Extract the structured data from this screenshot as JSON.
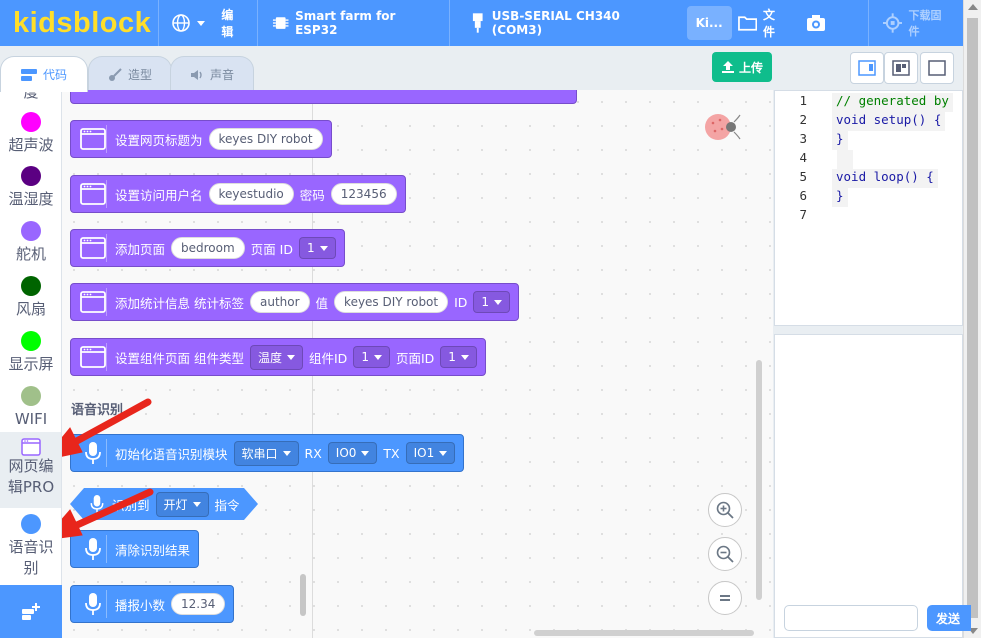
{
  "menubar": {
    "logo": "kidsblock",
    "edit": "编辑",
    "project": "Smart farm for ESP32",
    "port": "USB-SERIAL CH340 (COM3)",
    "kit": "Ki...",
    "file": "文件",
    "download_firmware": "下载固件"
  },
  "tabs": {
    "code": "代码",
    "costume": "造型",
    "sound": "声音"
  },
  "toolbar": {
    "upload": "上传"
  },
  "categories": [
    {
      "label": "度",
      "color": "#c0c0c0"
    },
    {
      "label": "超声波",
      "color": "#ff00ff"
    },
    {
      "label": "温湿度",
      "color": "#5b0082"
    },
    {
      "label": "舵机",
      "color": "#9966ff"
    },
    {
      "label": "风扇",
      "color": "#006400"
    },
    {
      "label": "显示屏",
      "color": "#00ff00"
    },
    {
      "label": "WIFI",
      "color": "#a0c08a"
    },
    {
      "label": "网页编辑PRO",
      "color": "#9966ff"
    },
    {
      "label": "语音识别",
      "color": "#4c97ff"
    }
  ],
  "blocks": {
    "set_title": {
      "label": "设置网页标题为",
      "value": "keyes DIY robot"
    },
    "set_user": {
      "label": "设置访问用户名",
      "user": "keyestudio",
      "pwd_label": "密码",
      "pwd": "123456"
    },
    "add_page": {
      "label": "添加页面",
      "name": "bedroom",
      "id_label": "页面 ID",
      "id": "1"
    },
    "add_stat": {
      "label": "添加统计信息 统计标签",
      "tag": "author",
      "val_label": "值",
      "val": "keyes DIY robot",
      "id_label": "ID",
      "id": "1"
    },
    "set_widget": {
      "label": "设置组件页面 组件类型",
      "type": "温度",
      "wid_label": "组件ID",
      "wid": "1",
      "pid_label": "页面ID",
      "pid": "1"
    },
    "section": "语音识别",
    "init_voice": {
      "label": "初始化语音识别模块",
      "mode": "软串口",
      "rx_label": "RX",
      "rx": "IO0",
      "tx_label": "TX",
      "tx": "IO1"
    },
    "recognized": {
      "label": "识别到",
      "cmd": "开灯",
      "suffix": "指令"
    },
    "clear": {
      "label": "清除识别结果"
    },
    "broadcast": {
      "label": "播报小数",
      "value": "12.34"
    }
  },
  "code": {
    "lines": [
      {
        "n": "1",
        "text": "// generated by",
        "type": "comment"
      },
      {
        "n": "2",
        "text": "void setup() {",
        "type": "code"
      },
      {
        "n": "3",
        "text": "}",
        "type": "code"
      },
      {
        "n": "4",
        "text": " ",
        "type": "code"
      },
      {
        "n": "5",
        "text": "void loop() {",
        "type": "code"
      },
      {
        "n": "6",
        "text": "}",
        "type": "code"
      },
      {
        "n": "7",
        "text": "",
        "type": "code"
      }
    ]
  },
  "serial": {
    "send": "发送"
  },
  "colors": {
    "primary": "#4c97ff",
    "logo": "#ffde2a",
    "upload": "#0fbd8c",
    "web_block": "#9966ff",
    "voice_block": "#4c97ff",
    "arrow": "#e8261c"
  }
}
